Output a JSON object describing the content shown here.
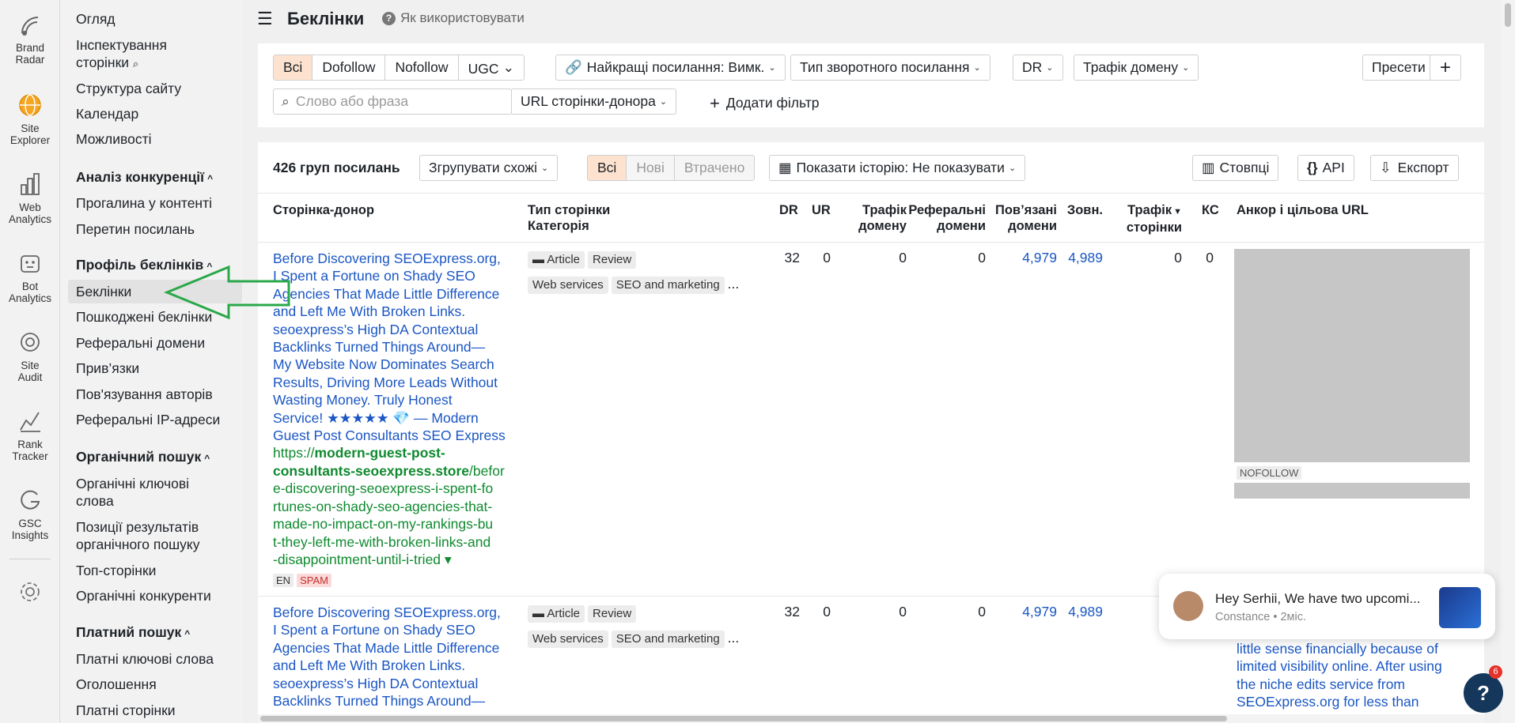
{
  "rail": [
    {
      "label_1": "Brand",
      "label_2": "Radar",
      "icon": "brand-radar-icon"
    },
    {
      "label_1": "Site",
      "label_2": "Explorer",
      "icon": "site-explorer-icon"
    },
    {
      "label_1": "Web",
      "label_2": "Analytics",
      "icon": "web-analytics-icon"
    },
    {
      "label_1": "Bot",
      "label_2": "Analytics",
      "icon": "bot-analytics-icon"
    },
    {
      "label_1": "Site",
      "label_2": "Audit",
      "icon": "site-audit-icon"
    },
    {
      "label_1": "Rank",
      "label_2": "Tracker",
      "icon": "rank-tracker-icon"
    },
    {
      "label_1": "GSC",
      "label_2": "Insights",
      "icon": "gsc-insights-icon"
    }
  ],
  "nav": {
    "overview": "Огляд",
    "inspect": "Інспектування сторінки",
    "structure": "Структура сайту",
    "calendar": "Календар",
    "opportunities": "Можливості",
    "competitors_head": "Аналіз конкуренції",
    "content_gap": "Прогалина у контенті",
    "link_intersect": "Перетин посилань",
    "backlink_head": "Профіль беклінків",
    "backlinks": "Беклінки",
    "broken": "Пошкоджені беклінки",
    "ref_domains": "Реферальні домени",
    "anchors": "Прив’язки",
    "authors": "Пов'язування авторів",
    "ref_ips": "Реферальні IP-адреси",
    "organic_head": "Органічний пошук",
    "organic_kw": "Органічні ключові слова",
    "organic_pos": "Позиції результатів органічного пошуку",
    "top_pages": "Топ-сторінки",
    "organic_comp": "Органічні конкуренти",
    "paid_head": "Платний пошук",
    "paid_kw": "Платні ключові слова",
    "ads": "Оголошення",
    "paid_pages": "Платні сторінки"
  },
  "header": {
    "title": "Беклінки",
    "help": "Як використовувати"
  },
  "filters": {
    "all": "Всі",
    "dofollow": "Dofollow",
    "nofollow": "Nofollow",
    "ugc": "UGC",
    "best_links": "Найкращі посилання: Вимк.",
    "backlink_type": "Тип зворотного посилання",
    "dr": "DR",
    "domain_traffic": "Трафік домену",
    "presets": "Пресети",
    "plus": "+",
    "search_placeholder": "Слово або фраза",
    "url_donor": "URL сторінки-донора",
    "add_filter": "Додати фільтр"
  },
  "toolbar": {
    "groups": "426 груп посилань",
    "group_similar": "Згрупувати схожі",
    "seg_all": "Всі",
    "seg_new": "Нові",
    "seg_lost": "Втрачено",
    "history": "Показати історію: Не показувати",
    "columns": "Стовпці",
    "api": "API",
    "export": "Експорт"
  },
  "columns": {
    "donor": "Сторінка-донор",
    "page_type_1": "Тип сторінки",
    "page_type_2": "Категорія",
    "dr": "DR",
    "ur": "UR",
    "dom_traffic_1": "Трафік",
    "dom_traffic_2": "домену",
    "ref_dom_1": "Реферальні",
    "ref_dom_2": "домени",
    "linked_1": "Пов’язані",
    "linked_2": "домени",
    "ext": "Зовн.",
    "page_traffic_1": "Трафік",
    "page_traffic_2": "сторінки",
    "kw": "КС",
    "anchor": "Анкор і цільова URL"
  },
  "rows": [
    {
      "title_lines": [
        "Before Discovering SEOExpress.org,",
        "I Spent a Fortune on Shady SEO",
        "Agencies That Made Little Difference",
        "and Left Me With Broken Links.",
        "seoexpress’s High DA Contextual",
        "Backlinks Turned Things Around—",
        "My Website Now Dominates Search",
        "Results, Driving More Leads Without",
        "Wasting Money. Truly Honest",
        "Service! ★★★★★ 💎 — Modern",
        "Guest Post Consultants SEO Express"
      ],
      "url_prefix": "https://",
      "url_domain_1": "modern-guest-post-",
      "url_domain_2": "consultants-seoexpress.store",
      "url_path_1": "/befor",
      "url_path_lines": [
        "e-discovering-seoexpress-i-spent-fo",
        "rtunes-on-shady-seo-agencies-that-",
        "made-no-impact-on-my-rankings-bu",
        "t-they-left-me-with-broken-links-and",
        "-disappointment-until-i-tried ▾"
      ],
      "lang": "EN",
      "spam": "SPAM",
      "tag_article": "Article",
      "tag_review": "Review",
      "cat_web": "Web services",
      "cat_seo": "SEO and marketing",
      "more": "...",
      "dr": "32",
      "ur": "0",
      "dom_traffic": "0",
      "ref_domains": "0",
      "linked": "4,979",
      "ext": "4,989",
      "page_traffic": "0",
      "kw": "0",
      "nofollow": "NOFOLLOW"
    },
    {
      "title_lines": [
        "Before Discovering SEOExpress.org,",
        "I Spent a Fortune on Shady SEO",
        "Agencies That Made Little Difference",
        "and Left Me With Broken Links.",
        "seoexpress’s High DA Contextual",
        "Backlinks Turned Things Around—"
      ],
      "tag_article": "Article",
      "tag_review": "Review",
      "cat_web": "Web services",
      "cat_seo": "SEO and marketing",
      "more": "...",
      "dr": "32",
      "ur": "0",
      "dom_traffic": "0",
      "ref_domains": "0",
      "linked": "4,979",
      "ext": "4,989",
      "anchor_lines": [
        "little sense financially because of",
        "limited visibility online. After using",
        "the niche edits service from",
        "SEOExpress.org for less than"
      ]
    }
  ],
  "chat": {
    "message": "Hey Serhii, We have two upcomi...",
    "author": "Constance • 2міс."
  },
  "help_badge": "6",
  "colors": {
    "link": "#1a56c4",
    "url_green": "#0f8a2f",
    "active_seg": "#fde3cf",
    "arrow": "#2aa84a"
  }
}
